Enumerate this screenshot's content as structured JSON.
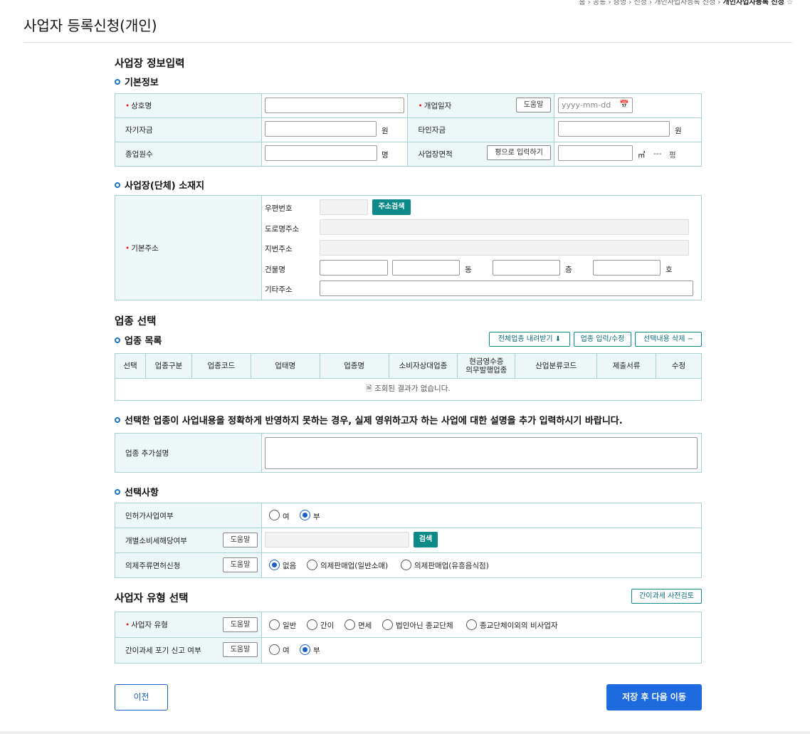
{
  "breadcrumb": [
    "홈",
    "공통",
    "증명",
    "신청",
    "개인사업자등록 신청",
    "개인사업자등록 신청"
  ],
  "page_title": "사업자 등록신청(개인)",
  "section_business_info": {
    "title": "사업장 정보입력",
    "basic_info": {
      "title": "기본정보",
      "trade_name_label": "상호명",
      "open_date_label": "개업일자",
      "help_label": "도움말",
      "open_date_placeholder": "yyyy-mm-dd",
      "own_capital_label": "자기자금",
      "other_capital_label": "타인자금",
      "won_unit": "원",
      "employees_label": "종업원수",
      "person_unit": "명",
      "area_label": "사업장면적",
      "pyeong_input_button": "평으로 입력하기",
      "sqm_unit": "㎡",
      "pyeong_value": "---",
      "pyeong_unit": "평"
    },
    "location": {
      "title": "사업장(단체) 소재지",
      "basic_address_label": "기본주소",
      "zip_label": "우편번호",
      "address_search_button": "주소검색",
      "road_address_label": "도로명주소",
      "lot_address_label": "지번주소",
      "building_label": "건물명",
      "dong_unit": "동",
      "floor_unit": "층",
      "ho_unit": "호",
      "other_address_label": "기타주소"
    }
  },
  "section_industry": {
    "title": "업종 선택",
    "list_title": "업종 목록",
    "download_all_button": "전체업종 내려받기",
    "input_edit_button": "업종 입력/수정",
    "delete_selected_button": "선택내용 삭제",
    "columns": [
      "선택",
      "업종구분",
      "업종코드",
      "업태명",
      "업종명",
      "소비자상대업종",
      "현금영수증\n의무발행업종",
      "산업분류코드",
      "제출서류",
      "수정"
    ],
    "empty_message": "조회된 결과가 없습니다."
  },
  "section_additional": {
    "notice": "선택한 업종이 사업내용을 정확하게 반영하지 못하는 경우, 실제 영위하고자 하는 사업에 대한 설명을 추가 입력하시기 바랍니다.",
    "extra_desc_label": "업종 추가설명"
  },
  "section_options": {
    "title": "선택사항",
    "license_label": "인허가사업여부",
    "yes": "여",
    "no": "부",
    "excise_label": "개별소비세해당여부",
    "search_button": "검색",
    "liquor_label": "의제주류면허신청",
    "liquor_options": [
      "없음",
      "의제판매업(일반소매)",
      "의제판매업(유흥음식점)"
    ]
  },
  "section_type": {
    "title": "사업자 유형 선택",
    "simplified_review_button": "간이과세 사전검토",
    "type_label": "사업자 유형",
    "type_options": [
      "일반",
      "간이",
      "면세",
      "법인아닌 종교단체",
      "종교단체이외의 비사업자"
    ],
    "waiver_label": "간이과세 포기 신고 여부"
  },
  "buttons": {
    "prev": "이전",
    "next": "저장 후 다음 이동"
  }
}
